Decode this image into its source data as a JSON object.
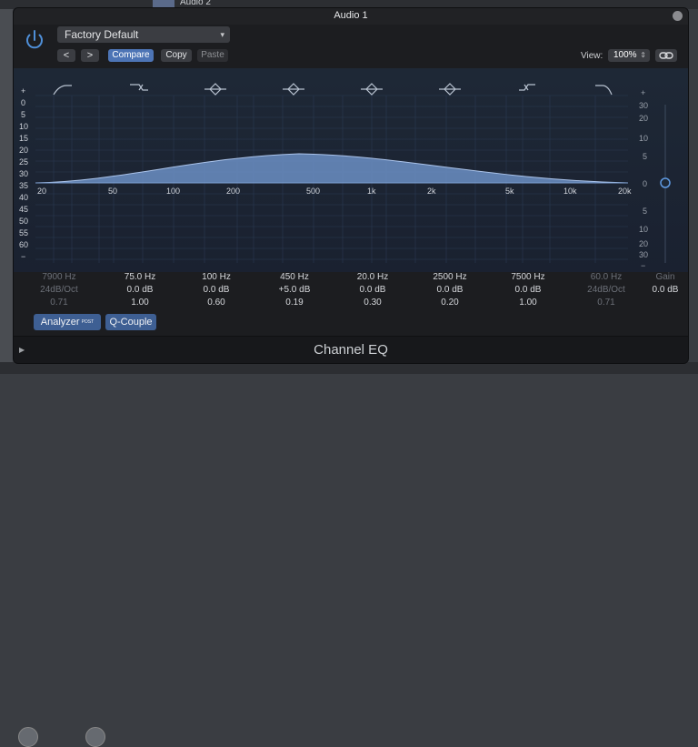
{
  "host": {
    "track_label": "Audio 2"
  },
  "window": {
    "title": "Audio 1"
  },
  "header": {
    "preset": "Factory Default",
    "prev": "<",
    "next": ">",
    "compare": "Compare",
    "copy": "Copy",
    "paste": "Paste",
    "view_label": "View:",
    "view_zoom": "100%"
  },
  "eq": {
    "left_db_labels": [
      "+",
      "0",
      "5",
      "10",
      "15",
      "20",
      "25",
      "30",
      "35",
      "40",
      "45",
      "50",
      "55",
      "60",
      "−"
    ],
    "right_gain_labels": [
      "+",
      "30",
      "20",
      "10",
      "5",
      "0",
      "5",
      "10",
      "20",
      "30",
      "−"
    ],
    "freq_labels": [
      "20",
      "50",
      "100",
      "200",
      "500",
      "1k",
      "2k",
      "5k",
      "10k",
      "20k"
    ],
    "bands": [
      {
        "freq": "7900 Hz",
        "gain": "24dB/Oct",
        "q": "0.71",
        "active": false
      },
      {
        "freq": "75.0 Hz",
        "gain": "0.0 dB",
        "q": "1.00",
        "active": true
      },
      {
        "freq": "100 Hz",
        "gain": "0.0 dB",
        "q": "0.60",
        "active": true
      },
      {
        "freq": "450 Hz",
        "gain": "+5.0 dB",
        "q": "0.19",
        "active": true
      },
      {
        "freq": "20.0 Hz",
        "gain": "0.0 dB",
        "q": "0.30",
        "active": true
      },
      {
        "freq": "2500 Hz",
        "gain": "0.0 dB",
        "q": "0.20",
        "active": true
      },
      {
        "freq": "7500 Hz",
        "gain": "0.0 dB",
        "q": "1.00",
        "active": true
      },
      {
        "freq": "60.0 Hz",
        "gain": "24dB/Oct",
        "q": "0.71",
        "active": false
      }
    ],
    "gain_label": "Gain",
    "gain_value": "0.0 dB"
  },
  "footer": {
    "analyzer": "Analyzer",
    "analyzer_post": "POST",
    "q_couple": "Q-Couple",
    "plugin_name": "Channel EQ"
  }
}
